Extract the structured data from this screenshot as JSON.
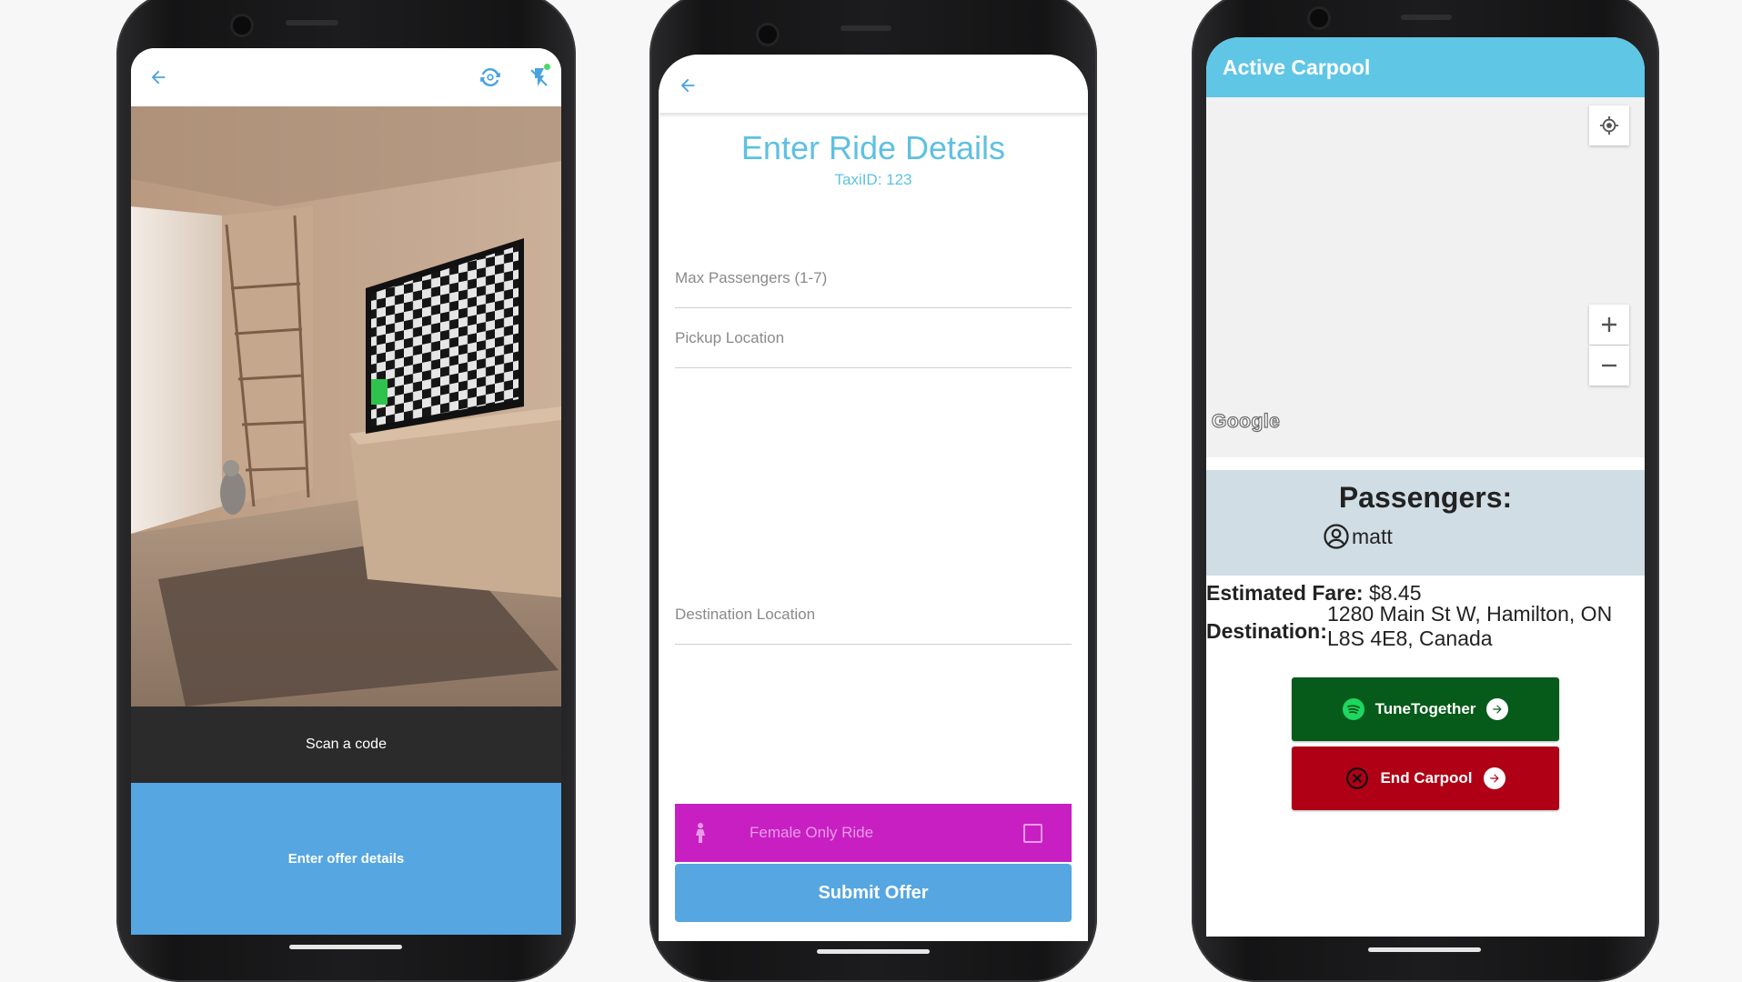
{
  "screens": {
    "scanner": {
      "back_icon": "arrow-back-icon",
      "switch_camera_icon": "camera-switch-icon",
      "flash_icon": "flash-off-icon",
      "scan_prompt": "Scan a code",
      "offer_button_label": "Enter offer details"
    },
    "ride_form": {
      "back_icon": "arrow-back-icon",
      "title": "Enter Ride Details",
      "taxi_id": "TaxiID: 123",
      "fields": [
        {
          "placeholder": "Max Passengers (1-7)"
        },
        {
          "placeholder": "Pickup Location"
        },
        {
          "placeholder": "Destination Location"
        }
      ],
      "female_only": {
        "label": "Female Only Ride",
        "checked": false,
        "icon": "female-icon"
      },
      "submit_label": "Submit Offer"
    },
    "active_carpool": {
      "title": "Active Carpool",
      "map": {
        "attribution": "Google",
        "locate_icon": "my-location-icon",
        "zoom_in_icon": "plus-icon",
        "zoom_out_icon": "minus-icon"
      },
      "passengers_title": "Passengers:",
      "passengers": [
        {
          "name": "matt",
          "icon": "account-circle-icon"
        }
      ],
      "fare_label": "Estimated Fare:",
      "fare_value": "$8.45",
      "destination_label": "Destination:",
      "destination_value": "1280 Main St W, Hamilton, ON L8S 4E8, Canada",
      "tune_button": {
        "label": "TuneTogether",
        "icon": "spotify-icon",
        "color": "#065a1a"
      },
      "end_button": {
        "label": "End Carpool",
        "icon": "cancel-icon",
        "color": "#b00016"
      }
    }
  },
  "colors": {
    "accent_blue": "#55a6e1",
    "title_cyan": "#5ec0e3",
    "female_magenta": "#c81fc3",
    "appbar_cyan": "#5fc6e6",
    "passenger_panel": "#d0dde4"
  }
}
